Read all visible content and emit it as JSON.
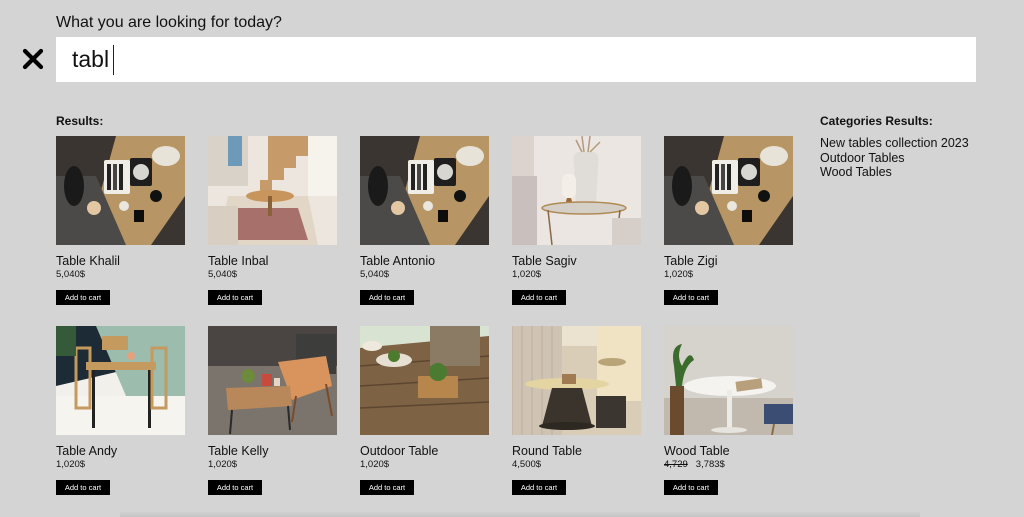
{
  "search": {
    "prompt": "What you are looking for today?",
    "value": "tabl"
  },
  "results": {
    "title": "Results:",
    "add_label": "Add to cart",
    "items": [
      {
        "name": "Table Khalil",
        "price": "5,040$",
        "old_price": "",
        "image": "overhead-desk-photo"
      },
      {
        "name": "Table Inbal",
        "price": "5,040$",
        "old_price": "",
        "image": "staircase-round-table-photo"
      },
      {
        "name": "Table Antonio",
        "price": "5,040$",
        "old_price": "",
        "image": "overhead-desk-photo"
      },
      {
        "name": "Table Sagiv",
        "price": "1,020$",
        "old_price": "",
        "image": "side-table-vase-photo"
      },
      {
        "name": "Table Zigi",
        "price": "1,020$",
        "old_price": "",
        "image": "overhead-desk-photo"
      },
      {
        "name": "Table Andy",
        "price": "1,020$",
        "old_price": "",
        "image": "dining-table-chairs-photo"
      },
      {
        "name": "Table Kelly",
        "price": "1,020$",
        "old_price": "",
        "image": "coffee-table-armchair-photo"
      },
      {
        "name": "Outdoor Table",
        "price": "1,020$",
        "old_price": "",
        "image": "wood-table-plants-photo"
      },
      {
        "name": "Round Table",
        "price": "4,500$",
        "old_price": "",
        "image": "round-pedestal-table-photo"
      },
      {
        "name": "Wood Table",
        "price": "3,783$",
        "old_price": "4,729",
        "image": "white-round-table-photo"
      }
    ]
  },
  "categories": {
    "title": "Categories Results:",
    "items": [
      "New tables collection 2023",
      "Outdoor Tables",
      "Wood Tables"
    ]
  },
  "colors": {
    "background": "#d4d4d4",
    "button": "#000000",
    "button_text": "#ffffff"
  }
}
